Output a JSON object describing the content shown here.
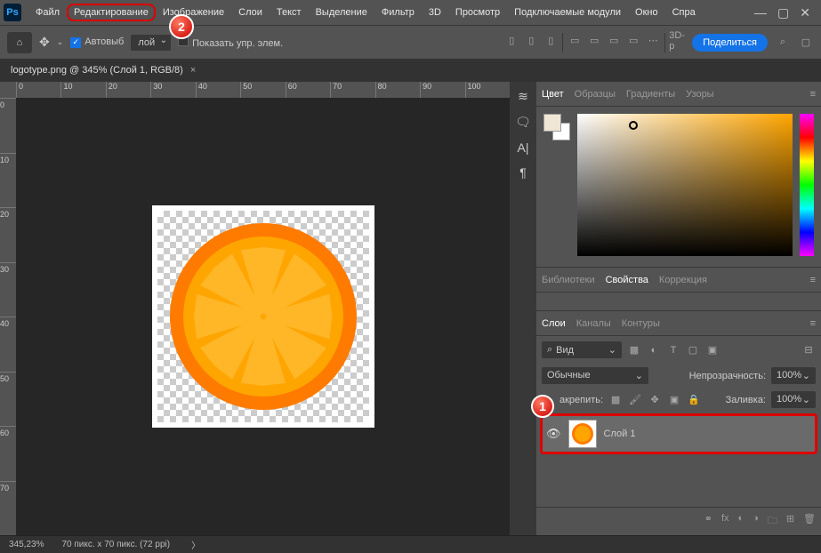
{
  "menu": {
    "items": [
      "Файл",
      "Редактирование",
      "Изображение",
      "Слои",
      "Текст",
      "Выделение",
      "Фильтр",
      "3D",
      "Просмотр",
      "Подключаемые модули",
      "Окно",
      "Спра"
    ]
  },
  "callouts": {
    "c1": "1",
    "c2": "2"
  },
  "optbar": {
    "auto_select": "Автовыб",
    "layer_dd": "лой",
    "show_ctrl": "Показать упр. элем.",
    "d3": "3D-р",
    "share": "Поделиться"
  },
  "doctab": {
    "title": "logotype.png @ 345% (Слой 1, RGB/8)"
  },
  "ruler_h": [
    "0",
    "10",
    "20",
    "30",
    "40",
    "50",
    "60",
    "70",
    "80",
    "90",
    "100"
  ],
  "ruler_v": [
    "0",
    "10",
    "20",
    "30",
    "40",
    "50",
    "60",
    "70"
  ],
  "panels": {
    "color": {
      "tabs": [
        "Цвет",
        "Образцы",
        "Градиенты",
        "Узоры"
      ]
    },
    "props": {
      "tabs": [
        "Библиотеки",
        "Свойства",
        "Коррекция"
      ]
    },
    "layers": {
      "tabs": [
        "Слои",
        "Каналы",
        "Контуры"
      ],
      "search_kind": "Вид",
      "blend": "Обычные",
      "opacity_lbl": "Непрозрачность:",
      "opacity_val": "100%",
      "lock_lbl": "акрепить:",
      "fill_lbl": "Заливка:",
      "fill_val": "100%",
      "layer1": "Слой 1"
    }
  },
  "status": {
    "zoom": "345,23%",
    "dims": "70 пикс. x 70 пикс. (72 ppi)"
  }
}
